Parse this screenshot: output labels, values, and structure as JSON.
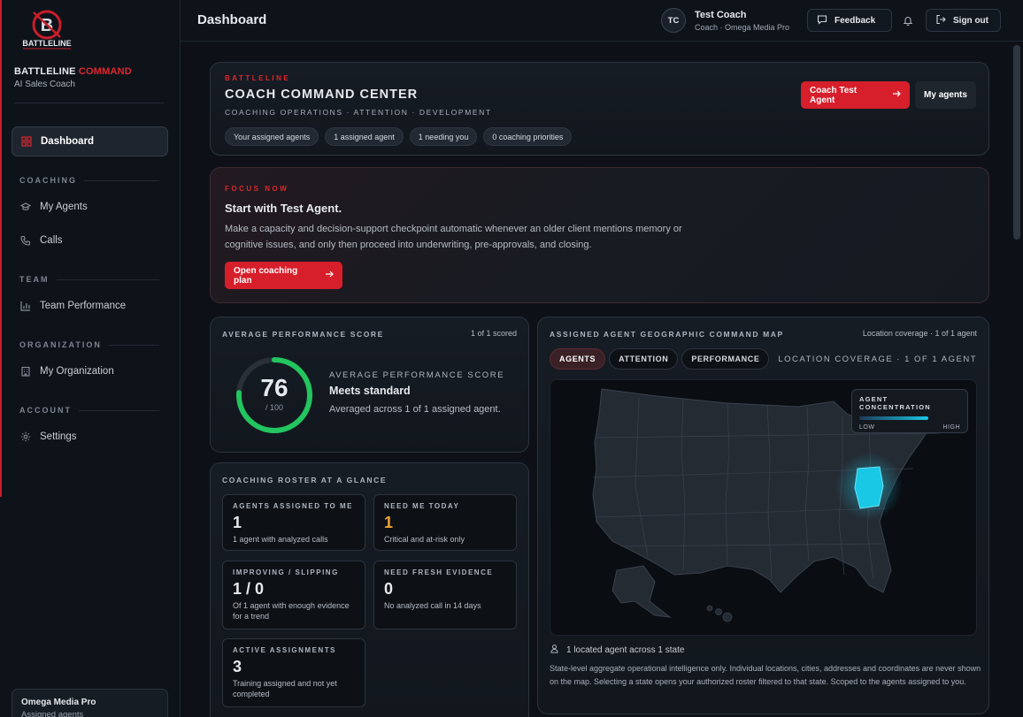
{
  "brand": {
    "name": "BATTLELINE",
    "name_accent": "COMMAND",
    "subtitle": "AI Sales Coach",
    "logo_text": "BATTLELINE"
  },
  "nav": {
    "dashboard": "Dashboard",
    "sections": {
      "coaching": "COACHING",
      "team": "TEAM",
      "organization": "ORGANIZATION",
      "account": "ACCOUNT"
    },
    "my_agents": "My Agents",
    "calls": "Calls",
    "team_performance": "Team Performance",
    "my_organization": "My Organization",
    "settings": "Settings"
  },
  "org_card": {
    "title": "Omega Media Pro",
    "subtitle": "Assigned agents"
  },
  "header": {
    "title": "Dashboard",
    "avatar_initials": "TC",
    "user_name": "Test Coach",
    "user_role": "Coach · Omega Media Pro",
    "feedback": "Feedback",
    "sign_out": "Sign out"
  },
  "command": {
    "eyebrow": "BATTLELINE",
    "title": "COACH COMMAND CENTER",
    "subtitle": "COACHING OPERATIONS · ATTENTION · DEVELOPMENT",
    "chips": [
      "Your assigned agents",
      "1 assigned agent",
      "1 needing you",
      "0 coaching priorities"
    ],
    "primary_button": "Coach Test Agent",
    "secondary_button": "My agents"
  },
  "focus": {
    "eyebrow": "FOCUS NOW",
    "title": "Start with Test Agent.",
    "body": "Make a capacity and decision-support checkpoint automatic whenever an older client mentions memory or cognitive issues, and only then proceed into underwriting, pre-approvals, and closing.",
    "button": "Open coaching plan"
  },
  "score": {
    "label": "AVERAGE PERFORMANCE SCORE",
    "meta": "1 of 1 scored",
    "value": "76",
    "max": "/ 100",
    "fill_fraction": 0.76,
    "right_label": "AVERAGE PERFORMANCE SCORE",
    "status": "Meets standard",
    "description": "Averaged across 1 of 1 assigned agent."
  },
  "roster": {
    "label": "COACHING ROSTER AT A GLANCE",
    "stats": [
      {
        "label": "AGENTS ASSIGNED TO ME",
        "value": "1",
        "desc": "1 agent with analyzed calls"
      },
      {
        "label": "NEED ME TODAY",
        "value": "1",
        "desc": "Critical and at-risk only"
      },
      {
        "label": "IMPROVING / SLIPPING",
        "value": "1 / 0",
        "desc": "Of 1 agent with enough evidence for a trend"
      },
      {
        "label": "NEED FRESH EVIDENCE",
        "value": "0",
        "desc": "No analyzed call in 14 days"
      },
      {
        "label": "ACTIVE ASSIGNMENTS",
        "value": "3",
        "desc": "Training assigned and not yet completed"
      }
    ]
  },
  "map": {
    "label": "ASSIGNED AGENT GEOGRAPHIC COMMAND MAP",
    "meta": "Location coverage · 1 of 1 agent",
    "tabs": [
      "AGENTS",
      "ATTENTION",
      "PERFORMANCE"
    ],
    "coverage": "LOCATION COVERAGE · 1 OF 1 AGENT",
    "legend": {
      "title": "AGENT CONCENTRATION",
      "low": "LOW",
      "high": "HIGH"
    },
    "footer": "1 located agent across 1 state",
    "note": "State-level aggregate operational intelligence only. Individual locations, cities, addresses and coordinates are never shown on the map. Selecting a state opens your authorized roster filtered to that state. Scoped to the agents assigned to you."
  },
  "colors": {
    "accent": "#d61f2b",
    "gauge": "#22c55e",
    "highlight": "#19c8e4",
    "amber": "#f0a234"
  }
}
